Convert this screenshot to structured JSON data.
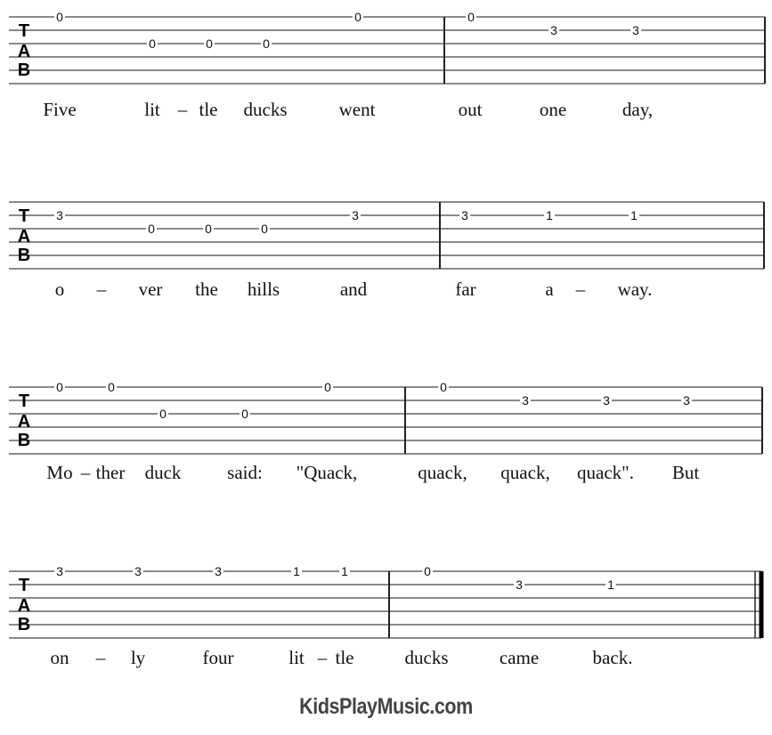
{
  "document": {
    "type": "guitar-tablature",
    "clef_label": [
      "T",
      "A",
      "B"
    ],
    "systems": [
      {
        "measures": [
          {
            "notes": [
              {
                "string": 1,
                "fret": "0"
              },
              {
                "string": 3,
                "fret": "0"
              },
              {
                "string": 3,
                "fret": "0"
              },
              {
                "string": 3,
                "fret": "0"
              },
              {
                "string": 1,
                "fret": "0"
              }
            ]
          },
          {
            "notes": [
              {
                "string": 1,
                "fret": "0"
              },
              {
                "string": 2,
                "fret": "3"
              },
              {
                "string": 2,
                "fret": "3"
              }
            ]
          }
        ],
        "lyrics": [
          "Five",
          "lit",
          "–",
          "tle",
          "ducks",
          "went",
          "out",
          "one",
          "day,"
        ]
      },
      {
        "measures": [
          {
            "notes": [
              {
                "string": 2,
                "fret": "3"
              },
              {
                "string": 3,
                "fret": "0"
              },
              {
                "string": 3,
                "fret": "0"
              },
              {
                "string": 3,
                "fret": "0"
              },
              {
                "string": 2,
                "fret": "3"
              }
            ]
          },
          {
            "notes": [
              {
                "string": 2,
                "fret": "3"
              },
              {
                "string": 2,
                "fret": "1"
              },
              {
                "string": 2,
                "fret": "1"
              }
            ]
          }
        ],
        "lyrics": [
          "o",
          "–",
          "ver",
          "the",
          "hills",
          "and",
          "far",
          "a",
          "–",
          "way."
        ]
      },
      {
        "measures": [
          {
            "notes": [
              {
                "string": 1,
                "fret": "0"
              },
              {
                "string": 1,
                "fret": "0"
              },
              {
                "string": 3,
                "fret": "0"
              },
              {
                "string": 3,
                "fret": "0"
              },
              {
                "string": 1,
                "fret": "0"
              }
            ]
          },
          {
            "notes": [
              {
                "string": 1,
                "fret": "0"
              },
              {
                "string": 2,
                "fret": "3"
              },
              {
                "string": 2,
                "fret": "3"
              },
              {
                "string": 2,
                "fret": "3"
              }
            ]
          }
        ],
        "lyrics": [
          "Mo",
          "–",
          "ther",
          "duck",
          "said:",
          "\"Quack,",
          "quack,",
          "quack,",
          "quack\".",
          "But"
        ]
      },
      {
        "measures": [
          {
            "notes": [
              {
                "string": 1,
                "fret": "3"
              },
              {
                "string": 1,
                "fret": "3"
              },
              {
                "string": 1,
                "fret": "3"
              },
              {
                "string": 1,
                "fret": "1"
              },
              {
                "string": 1,
                "fret": "1"
              }
            ]
          },
          {
            "notes": [
              {
                "string": 1,
                "fret": "0"
              },
              {
                "string": 2,
                "fret": "3"
              },
              {
                "string": 2,
                "fret": "1"
              }
            ]
          }
        ],
        "lyrics": [
          "on",
          "–",
          "ly",
          "four",
          "lit",
          "–",
          "tle",
          "ducks",
          "came",
          "back."
        ],
        "final_barline": true
      }
    ]
  },
  "footer": {
    "brand": "KidsPlayMusic.com"
  }
}
